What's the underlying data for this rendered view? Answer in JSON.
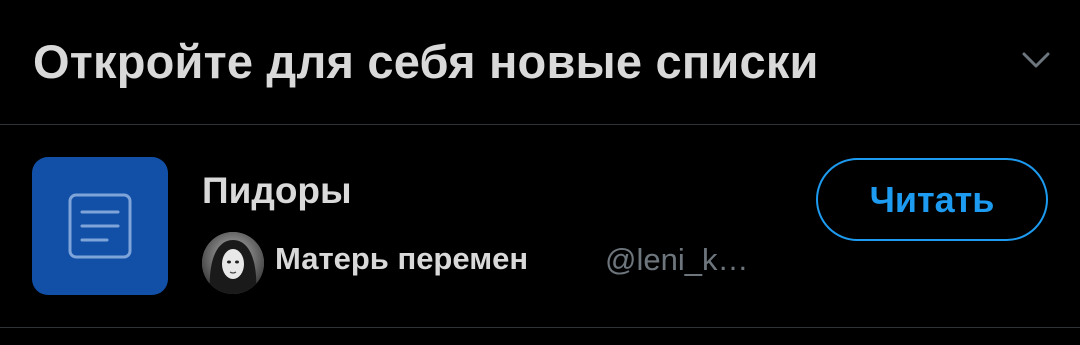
{
  "header": {
    "title": "Откройте для себя новые списки",
    "collapse_icon": "chevron-down-icon"
  },
  "list": {
    "icon": "list-document-icon",
    "name": "Пидоры",
    "owner_name": "Матерь перемен",
    "owner_handle": "@leni_k…",
    "follow_label": "Читать"
  },
  "colors": {
    "background": "#000000",
    "text": "#d9d9d9",
    "secondary_text": "#6e767d",
    "accent": "#1d9bf0",
    "list_cover": "#1250a8",
    "divider": "#2f3336"
  }
}
